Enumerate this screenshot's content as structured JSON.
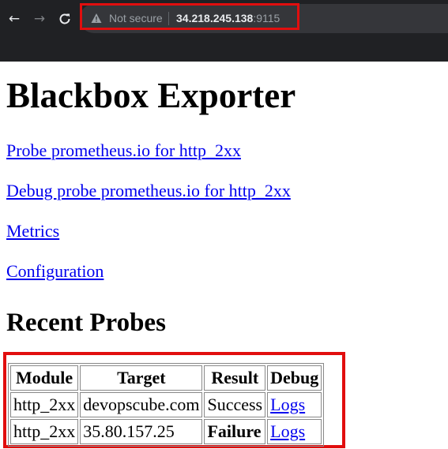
{
  "browser": {
    "security_label": "Not secure",
    "url_host": "34.218.245.138",
    "url_port": ":9115",
    "icons": {
      "back": "arrow-left-icon",
      "forward": "arrow-right-icon",
      "reload": "reload-icon",
      "security": "warning-triangle-icon"
    }
  },
  "page": {
    "title": "Blackbox Exporter",
    "links": {
      "probe": "Probe prometheus.io for http_2xx",
      "debug": "Debug probe prometheus.io for http_2xx",
      "metrics": "Metrics",
      "configuration": "Configuration"
    },
    "section_title": "Recent Probes",
    "table": {
      "headers": [
        "Module",
        "Target",
        "Result",
        "Debug"
      ],
      "rows": [
        {
          "module": "http_2xx",
          "target": "devopscube.com",
          "result": "Success",
          "debug": "Logs"
        },
        {
          "module": "http_2xx",
          "target": "35.80.157.25",
          "result": "Failure",
          "debug": "Logs"
        }
      ]
    }
  },
  "colors": {
    "highlight": "#e10e0e",
    "link": "#0000ee",
    "chrome_bg": "#202124"
  }
}
